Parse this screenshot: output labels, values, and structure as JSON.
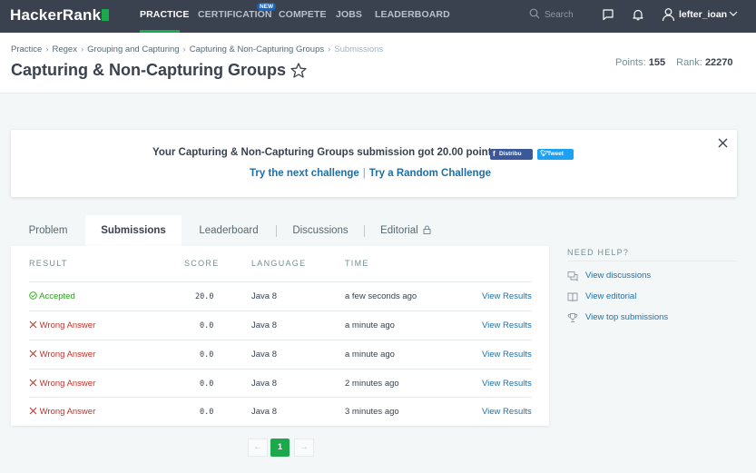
{
  "nav": {
    "logo": "HackerRank",
    "links": [
      "PRACTICE",
      "CERTIFICATION",
      "COMPETE",
      "JOBS",
      "LEADERBOARD"
    ],
    "new_badge": "NEW",
    "search_placeholder": "Search",
    "username": "lefter_ioan"
  },
  "header": {
    "breadcrumb": [
      "Practice",
      "Regex",
      "Grouping and Capturing",
      "Capturing & Non-Capturing Groups",
      "Submissions"
    ],
    "title": "Capturing & Non-Capturing Groups",
    "points_label": "Points:",
    "points_value": "155",
    "rank_label": "Rank:",
    "rank_value": "22270"
  },
  "banner": {
    "message": "Your Capturing & Non-Capturing Groups submission got 20.00 points.",
    "facebook_label": "Distribu",
    "tweet_label": "Tweet",
    "next_link": "Try the next challenge",
    "separator": "|",
    "random_link": "Try a Random Challenge"
  },
  "tabs": [
    "Problem",
    "Submissions",
    "Leaderboard",
    "Discussions",
    "Editorial"
  ],
  "table": {
    "headers": [
      "RESULT",
      "SCORE",
      "LANGUAGE",
      "TIME"
    ],
    "rows": [
      {
        "result": "Accepted",
        "score": "20.0",
        "language": "Java 8",
        "time": "a few seconds ago",
        "action": "View Results"
      },
      {
        "result": "Wrong Answer",
        "score": "0.0",
        "language": "Java 8",
        "time": "a minute ago",
        "action": "View Results"
      },
      {
        "result": "Wrong Answer",
        "score": "0.0",
        "language": "Java 8",
        "time": "a minute ago",
        "action": "View Results"
      },
      {
        "result": "Wrong Answer",
        "score": "0.0",
        "language": "Java 8",
        "time": "2 minutes ago",
        "action": "View Results"
      },
      {
        "result": "Wrong Answer",
        "score": "0.0",
        "language": "Java 8",
        "time": "3 minutes ago",
        "action": "View Results"
      }
    ]
  },
  "pagination": {
    "prev": "←",
    "current": "1",
    "next": "→"
  },
  "help": {
    "title": "NEED HELP?",
    "items": [
      "View discussions",
      "View editorial",
      "View top submissions"
    ]
  },
  "colors": {
    "nav_bg": "#39424e",
    "accent_green": "#1ba94c",
    "link_blue": "#1f6fa6",
    "error_red": "#c4312a",
    "success_green": "#2ca01c"
  },
  "icons": [
    "search-icon",
    "chat-icon",
    "bell-icon",
    "user-icon",
    "chevron-down-icon",
    "star-icon",
    "close-icon",
    "lock-icon",
    "check-circle-icon",
    "x-icon",
    "discussions-icon",
    "book-icon",
    "trophy-icon"
  ]
}
